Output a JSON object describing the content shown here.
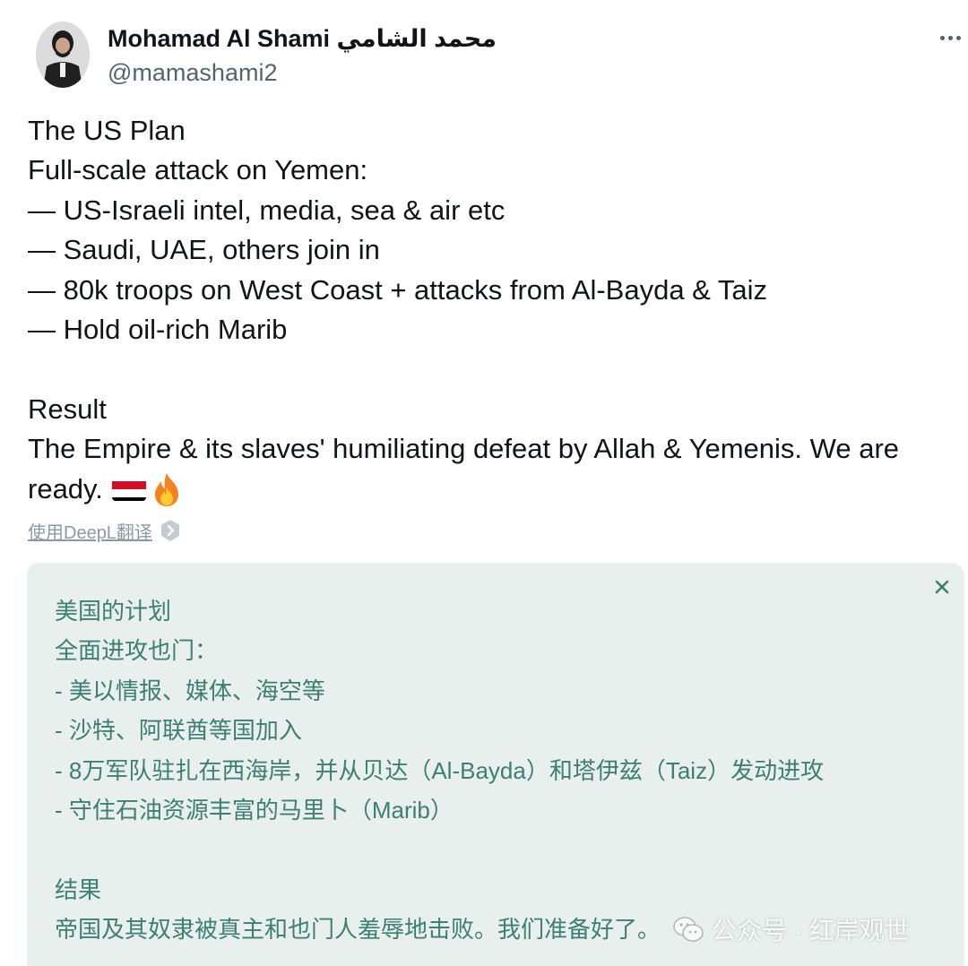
{
  "author": {
    "display_name": "Mohamad Al Shami محمد الشامي",
    "handle": "@mamashami2",
    "avatar_icon": "profile-photo"
  },
  "more_icon": "more-horizontal-icon",
  "tweet": {
    "lines": [
      "The US Plan",
      "Full-scale attack on Yemen:",
      "— US-Israeli intel, media, sea & air etc",
      "— Saudi, UAE, others join in",
      "— 80k troops on West Coast + attacks from Al-Bayda & Taiz",
      "— Hold oil-rich Marib",
      "",
      "Result",
      "The Empire & its slaves' humiliating defeat by Allah & Yemenis. We are",
      "ready."
    ],
    "emojis": [
      "yemen-flag-icon",
      "fire-icon"
    ]
  },
  "translate": {
    "link_label": "使用DeepL翻译",
    "icon": "deepl-icon"
  },
  "translation": {
    "close_icon": "close-icon",
    "lines": [
      "美国的计划",
      "全面进攻也门：",
      "- 美以情报、媒体、海空等",
      "- 沙特、阿联酋等国加入",
      "- 8万军队驻扎在西海岸，并从贝达（Al-Bayda）和塔伊兹（Taiz）发动进攻",
      "- 守住石油资源丰富的马里卜（Marib）",
      "",
      "结果",
      "帝国及其奴隶被真主和也门人羞辱地击败。我们准备好了。"
    ]
  },
  "watermark": {
    "icon": "wechat-icon",
    "text": "公众号 · 红岸观世"
  },
  "colors": {
    "text": "#0f1419",
    "secondary": "#536471",
    "translation_bg": "#e8efed",
    "translation_text": "#3d7f73"
  }
}
